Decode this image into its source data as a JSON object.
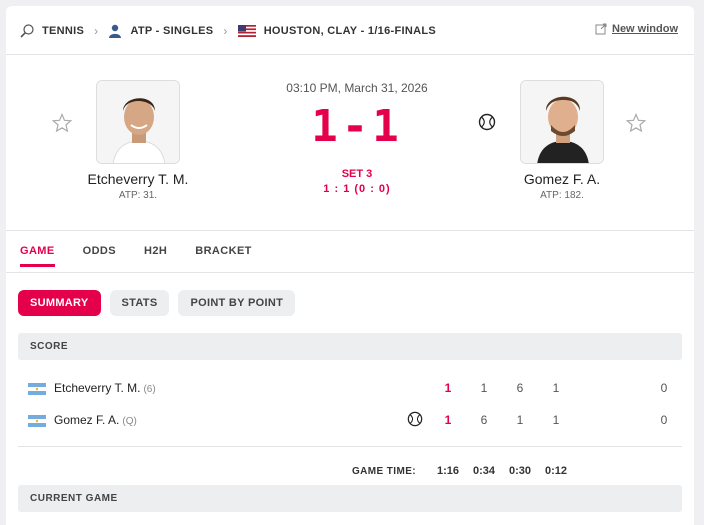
{
  "breadcrumb": {
    "sport": "TENNIS",
    "category": "ATP - SINGLES",
    "tournament": "HOUSTON, CLAY - 1/16-FINALS"
  },
  "new_window_label": "New window",
  "match": {
    "datetime": "03:10 PM, March 31, 2026",
    "score": "1-1",
    "set_label": "SET 3",
    "set_score": "1 : 1 (0 : 0)"
  },
  "players": {
    "home": {
      "name": "Etcheverry T. M.",
      "rank": "ATP: 31.",
      "seed": "(6)",
      "flag": "argentina"
    },
    "away": {
      "name": "Gomez F. A.",
      "rank": "ATP: 182.",
      "seed": "(Q)",
      "flag": "argentina",
      "serving": true
    }
  },
  "tabs": [
    "GAME",
    "ODDS",
    "H2H",
    "BRACKET"
  ],
  "subtabs": [
    "SUMMARY",
    "STATS",
    "POINT BY POINT"
  ],
  "score_section_label": "SCORE",
  "score_table": {
    "home": [
      "1",
      "1",
      "6",
      "1",
      "0"
    ],
    "away": [
      "1",
      "6",
      "1",
      "1",
      "0"
    ]
  },
  "game_time_label": "GAME TIME:",
  "game_times": [
    "1:16",
    "0:34",
    "0:30",
    "0:12"
  ],
  "current_game_label": "CURRENT GAME",
  "colors": {
    "accent": "#e5004b",
    "pill_bg": "#eceef0"
  }
}
